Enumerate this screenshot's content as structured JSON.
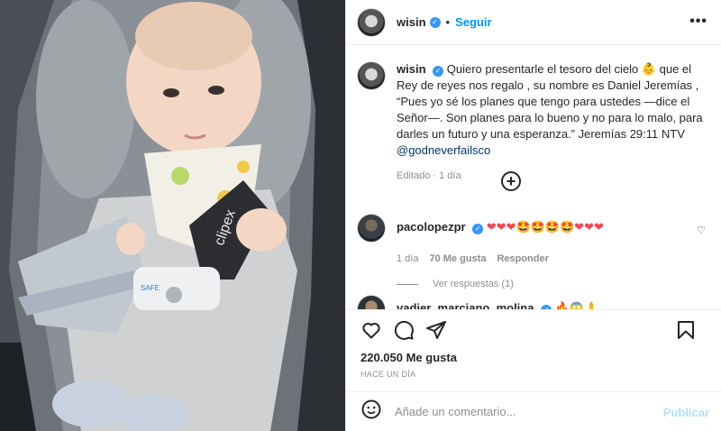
{
  "post": {
    "author": "wisin",
    "follow_label": "Seguir",
    "separator": "•",
    "more_label": "•••"
  },
  "caption": {
    "author": "wisin",
    "text_1": "Quiero presentarle el tesoro del cielo 👶 que el Rey de reyes nos regalo , su nombre es Daniel Jeremías , “Pues yo sé los planes que tengo para ustedes —dice el Señor—. Son planes para lo bueno y no para lo malo, para darles un futuro y una esperanza.” Jeremías 29:11 NTV ",
    "mention": "@godneverfailsco",
    "edited": "Editado",
    "time": "1 día"
  },
  "load_more": {
    "icon": "plus-circle-icon",
    "label": "+"
  },
  "comments": [
    {
      "author": "pacolopezpr",
      "text": "❤❤❤🤩🤩🤩🤩❤❤❤",
      "time": "1 día",
      "likes": "70 Me gusta",
      "reply": "Responder",
      "view_replies": "Ver respuestas (1)"
    },
    {
      "author": "vadier_marciano_molina",
      "text": "🔥😱🙏"
    }
  ],
  "actions": {
    "like_icon": "heart-icon",
    "comment_icon": "comment-icon",
    "share_icon": "paper-plane-icon",
    "save_icon": "bookmark-icon"
  },
  "likes_count": "220.050 Me gusta",
  "posted_ago": "HACE UN DÍA",
  "add_comment": {
    "placeholder": "Añade un comentario...",
    "publish": "Publicar",
    "emoji_icon": "emoji-icon"
  },
  "colors": {
    "link_blue": "#0095f6",
    "publish_disabled": "#b2dffc",
    "muted_text": "#8e8e8e",
    "verified_blue": "#3897f0",
    "heart_red": "#ed4956"
  },
  "photo": {
    "baby_bib_brand": "clipex",
    "buckle_label": "SAFE"
  }
}
